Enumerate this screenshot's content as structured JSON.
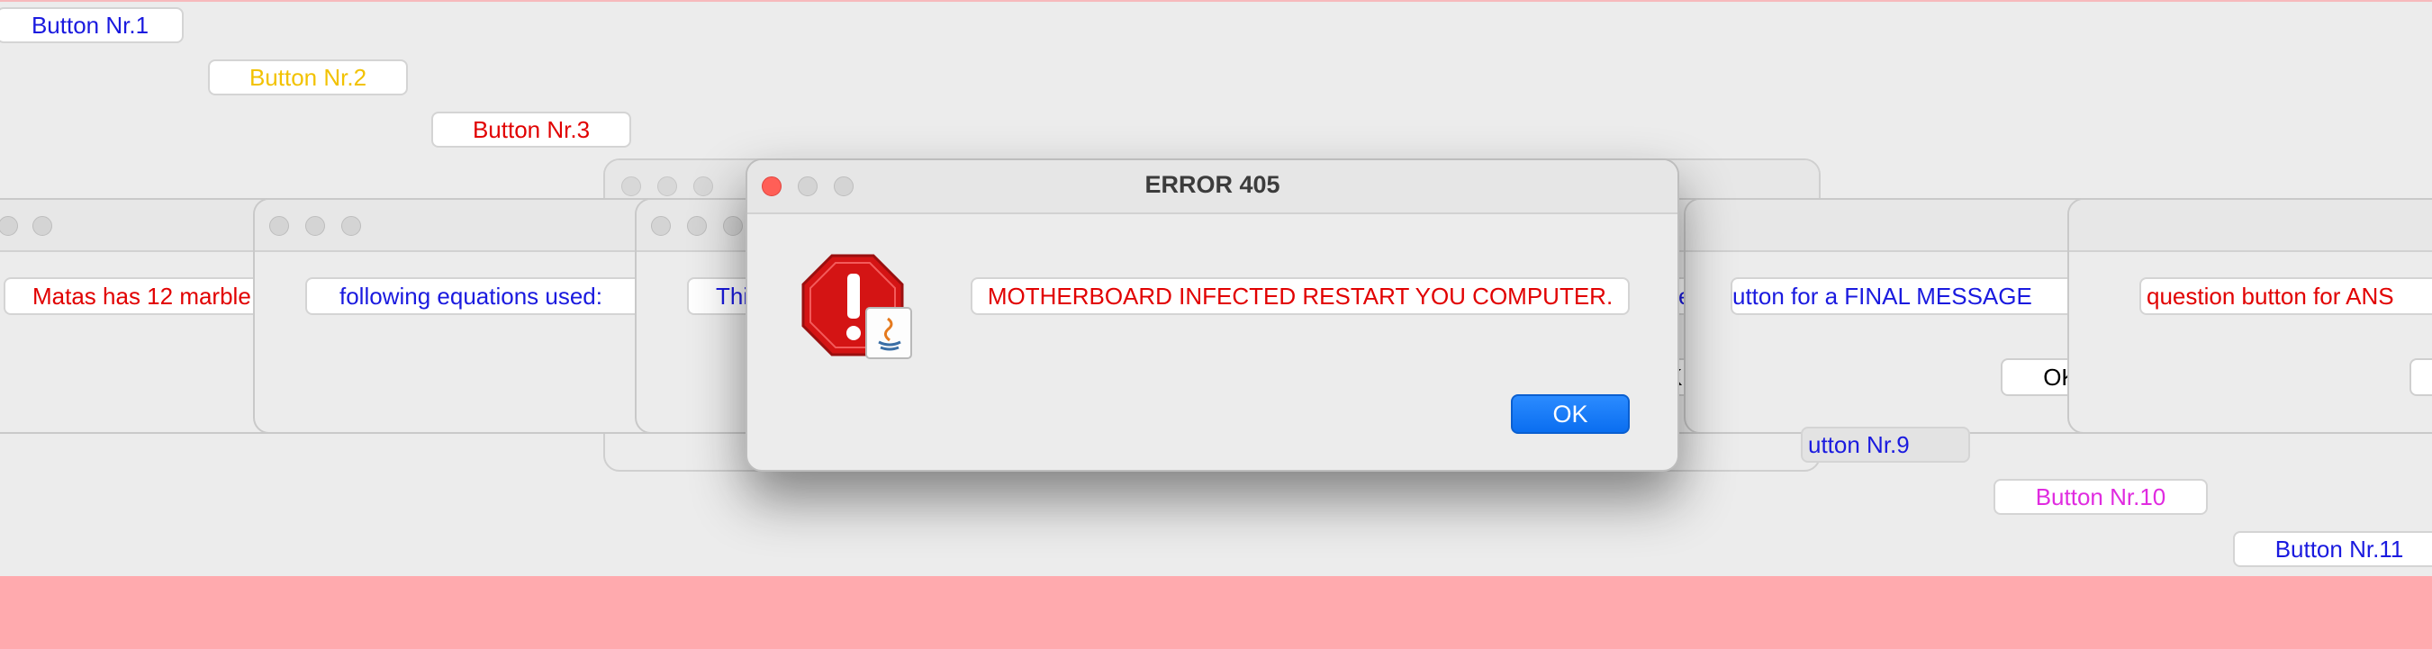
{
  "background_buttons": [
    {
      "label": "Button Nr.1",
      "color": "#1a1adf"
    },
    {
      "label": "Button Nr.2",
      "color": "#f2c200"
    },
    {
      "label": "Button Nr.3",
      "color": "#e10000"
    },
    {
      "label": "utton Nr.9",
      "color": "#1a1adf"
    },
    {
      "label": "Button Nr.10",
      "color": "#e02be0"
    },
    {
      "label": "Button Nr.11",
      "color": "#1a1adf"
    }
  ],
  "background_windows": [
    {
      "message": "Matas has 12 marble",
      "color": "#e10000"
    },
    {
      "message": "following equations used:",
      "color": "#1a1adf"
    },
    {
      "message": "Thi",
      "color": "#1a1adf"
    },
    {
      "message": "ye!",
      "color": "#1a1adf"
    },
    {
      "message": "utton for a FINAL MESSAGE",
      "color": "#1a1adf",
      "ok": "OK"
    },
    {
      "message": "question button for ANS",
      "color": "#e10000"
    }
  ],
  "fragment_ok": "K",
  "main_dialog": {
    "title": "ERROR 405",
    "message": "MOTHERBOARD INFECTED RESTART YOU COMPUTER.",
    "message_color": "#e10000",
    "ok_label": "OK",
    "icon": "stop-warning-java-icon"
  },
  "colors": {
    "background": "#ececec",
    "bottom_strip": "#ffaaae",
    "accent_blue": "#0a6ef0"
  }
}
